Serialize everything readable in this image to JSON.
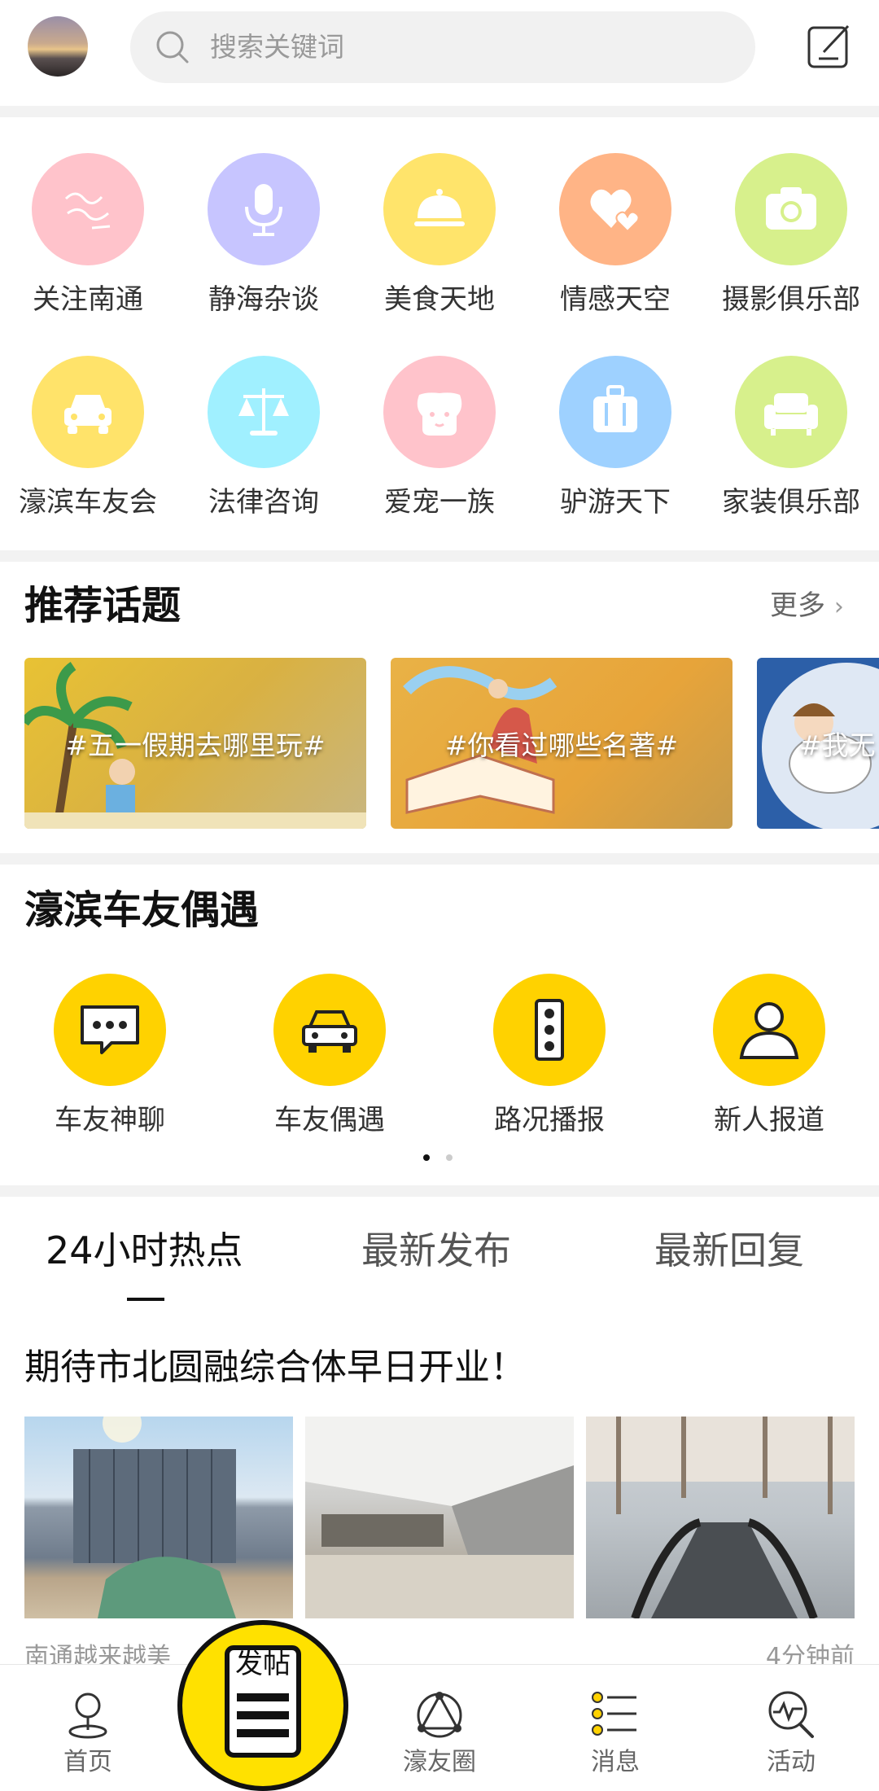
{
  "header": {
    "search_placeholder": "搜索关键词"
  },
  "categories": [
    {
      "label": "关注南通",
      "color": "#ffc3cb",
      "icon": "handwriting-logo-icon"
    },
    {
      "label": "静海杂谈",
      "color": "#c7c5ff",
      "icon": "microphone-icon"
    },
    {
      "label": "美食天地",
      "color": "#ffe46b",
      "icon": "food-cloche-icon"
    },
    {
      "label": "情感天空",
      "color": "#ffb486",
      "icon": "hearts-icon"
    },
    {
      "label": "摄影俱乐部",
      "color": "#d7f08c",
      "icon": "camera-icon"
    },
    {
      "label": "濠滨车友会",
      "color": "#ffe36a",
      "icon": "car-icon"
    },
    {
      "label": "法律咨询",
      "color": "#a0f0ff",
      "icon": "scale-icon"
    },
    {
      "label": "爱宠一族",
      "color": "#ffc3cb",
      "icon": "dog-icon"
    },
    {
      "label": "驴游天下",
      "color": "#9ed1ff",
      "icon": "suitcase-icon"
    },
    {
      "label": "家装俱乐部",
      "color": "#d7f08c",
      "icon": "sofa-icon"
    }
  ],
  "topics": {
    "title": "推荐话题",
    "more": "更多",
    "items": [
      {
        "text": "#五一假期去哪里玩#"
      },
      {
        "text": "#你看过哪些名著#"
      },
      {
        "text": "#我无"
      }
    ]
  },
  "car_section": {
    "title": "濠滨车友偶遇",
    "items": [
      {
        "label": "车友神聊",
        "icon": "chat-bubble-icon"
      },
      {
        "label": "车友偶遇",
        "icon": "car-icon"
      },
      {
        "label": "路况播报",
        "icon": "traffic-light-icon"
      },
      {
        "label": "新人报道",
        "icon": "person-icon"
      }
    ],
    "page_count": 2,
    "current_page": 1
  },
  "tabs": [
    {
      "label": "24小时热点",
      "active": true
    },
    {
      "label": "最新发布",
      "active": false
    },
    {
      "label": "最新回复",
      "active": false
    }
  ],
  "post": {
    "title": "期待市北圆融综合体早日开业！",
    "meta": "南通越来越美",
    "time": "4分钟前"
  },
  "bottom_nav": {
    "items": [
      {
        "label": "首页",
        "icon": "location-pin-icon"
      },
      {
        "label": "濠友圈",
        "icon": "circle-network-icon"
      },
      {
        "label": "消息",
        "icon": "message-list-icon"
      },
      {
        "label": "活动",
        "icon": "activity-search-icon"
      }
    ],
    "post_button": "发帖"
  }
}
